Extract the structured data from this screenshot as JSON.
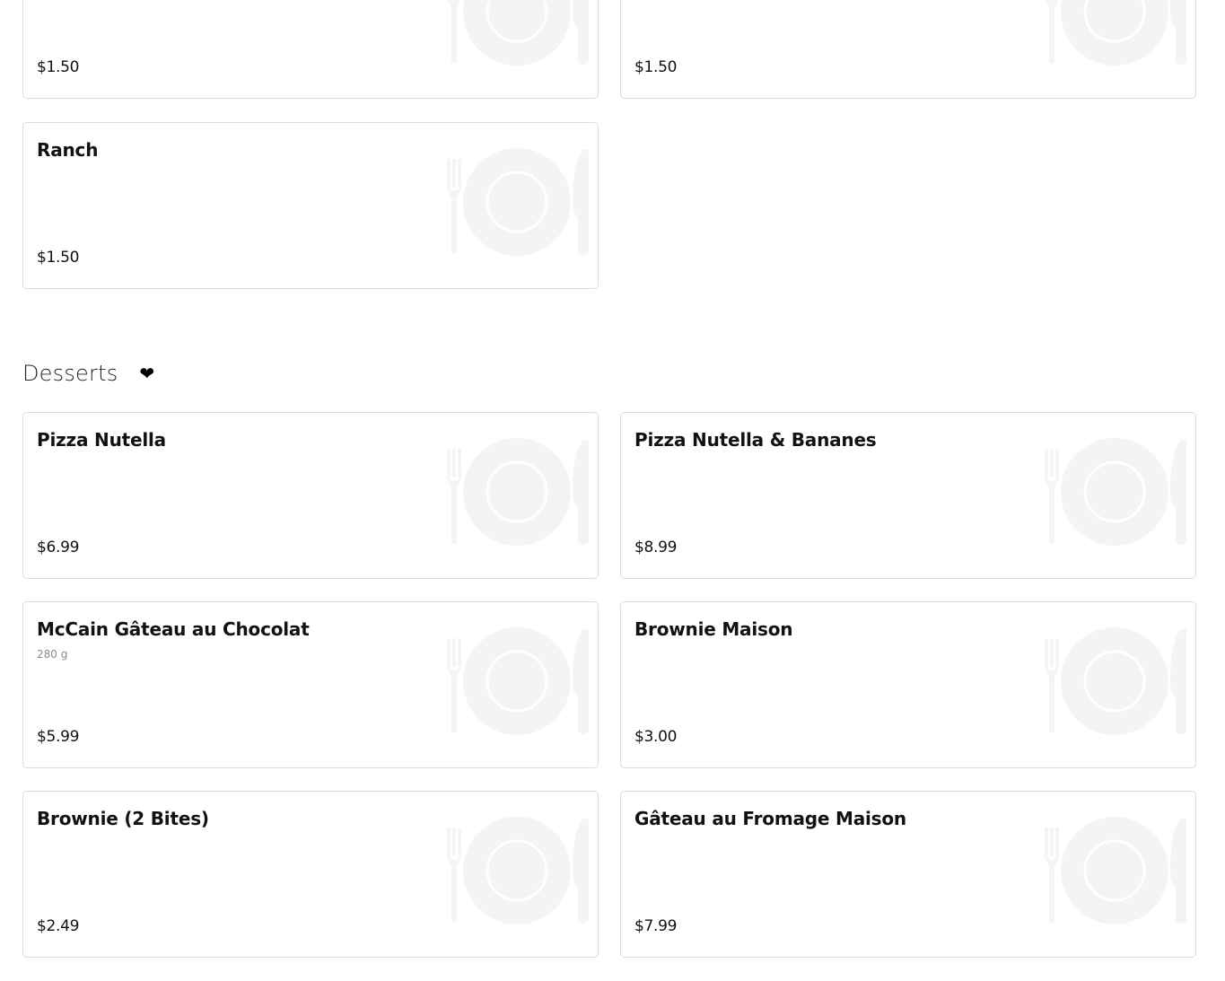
{
  "sauces": {
    "items": [
      {
        "name": "",
        "description": "",
        "price": "$1.50"
      },
      {
        "name": "",
        "description": "",
        "price": "$1.50"
      },
      {
        "name": "Ranch",
        "description": "",
        "price": "$1.50"
      }
    ]
  },
  "desserts": {
    "title": "Desserts",
    "favorite_icon": "heart-icon",
    "items": [
      {
        "name": "Pizza Nutella",
        "description": "",
        "price": "$6.99"
      },
      {
        "name": "Pizza Nutella & Bananes",
        "description": "",
        "price": "$8.99"
      },
      {
        "name": "McCain Gâteau au Chocolat",
        "description": "280 g",
        "price": "$5.99"
      },
      {
        "name": "Brownie Maison",
        "description": "",
        "price": "$3.00"
      },
      {
        "name": "Brownie (2 Bites)",
        "description": "",
        "price": "$2.49"
      },
      {
        "name": "Gâteau au Fromage Maison",
        "description": "",
        "price": "$7.99"
      }
    ]
  },
  "placeholder_icon": "plate-cutlery-icon",
  "colors": {
    "card_border": "#dcdcdc",
    "placeholder": "#f4f4f4",
    "text": "#111111",
    "muted_text": "#8a8a8a"
  }
}
